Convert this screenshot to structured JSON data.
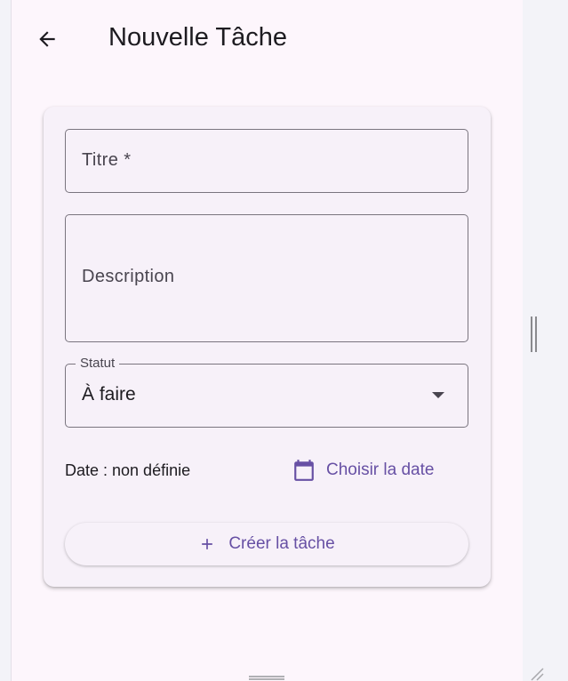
{
  "appbar": {
    "title": "Nouvelle Tâche",
    "back_icon": "arrow-back-icon"
  },
  "form": {
    "title_field": {
      "placeholder": "Titre *",
      "value": ""
    },
    "description_field": {
      "placeholder": "Description",
      "value": ""
    },
    "status_field": {
      "label": "Statut",
      "value": "À faire",
      "icon": "dropdown-arrow-icon"
    },
    "date_text": "Date : non définie",
    "date_button": {
      "label": "Choisir la date",
      "icon": "calendar-icon"
    },
    "create_button": {
      "label": "Créer la tâche",
      "icon": "plus-icon"
    }
  },
  "colors": {
    "primary": "#6750a4",
    "surface": "#fdf6fc",
    "card": "#f7f1f9",
    "outline": "#7a757f",
    "on_surface": "#1d1b20"
  }
}
